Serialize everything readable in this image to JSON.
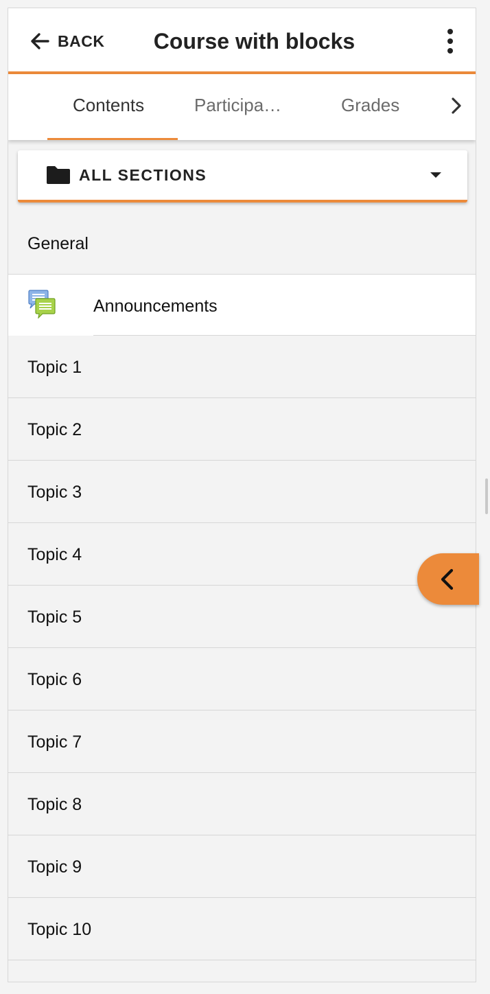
{
  "header": {
    "back_label": "BACK",
    "title": "Course with blocks",
    "more_icon": "more-vertical-icon"
  },
  "tabs": [
    {
      "label": "Contents",
      "active": true
    },
    {
      "label": "Participa…",
      "active": false
    },
    {
      "label": "Grades",
      "active": false
    }
  ],
  "section_selector": {
    "label": "ALL SECTIONS",
    "icon": "folder-icon"
  },
  "list": {
    "general": "General",
    "module": {
      "label": "Announcements",
      "icon": "forum-icon"
    },
    "topics": [
      "Topic 1",
      "Topic 2",
      "Topic 3",
      "Topic 4",
      "Topic 5",
      "Topic 6",
      "Topic 7",
      "Topic 8",
      "Topic 9",
      "Topic 10"
    ]
  },
  "colors": {
    "accent": "#ec8a3a",
    "background": "#f3f3f3",
    "surface": "#ffffff",
    "text": "#111111"
  },
  "blocks_toggle": {
    "icon": "chevron-left-icon"
  }
}
